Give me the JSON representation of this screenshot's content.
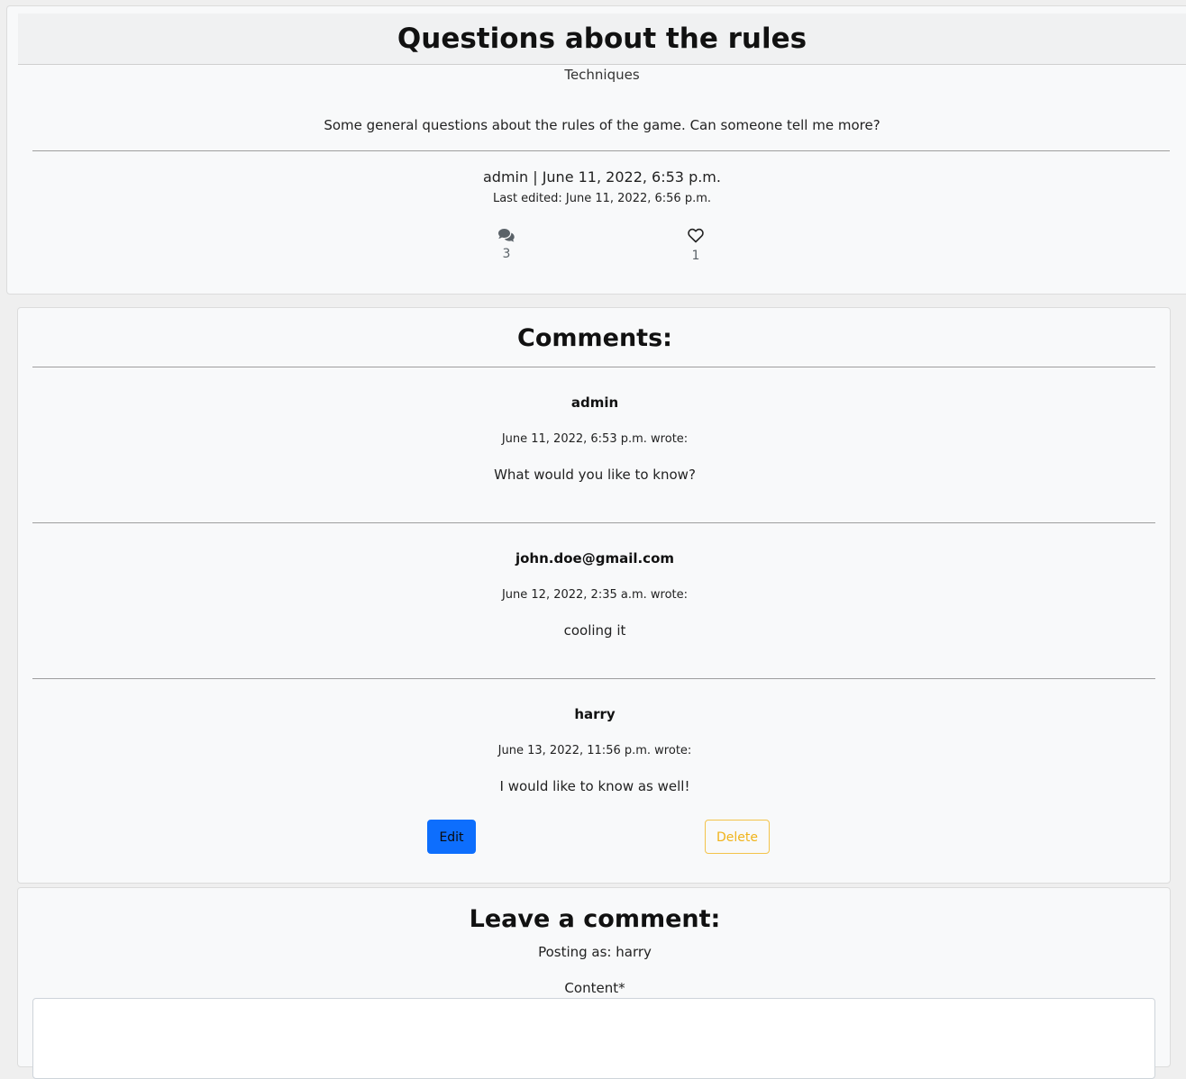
{
  "post": {
    "title": "Questions about the rules",
    "category": "Techniques",
    "body": "Some general questions about the rules of the game. Can someone tell me more?",
    "meta": "admin | June 11, 2022, 6:53 p.m.",
    "last_edited": "Last edited: June 11, 2022, 6:56 p.m.",
    "comment_count": "3",
    "like_count": "1",
    "icons": {
      "comments": "comments-icon",
      "likes": "heart-outline-icon"
    }
  },
  "comments": {
    "title": "Comments:",
    "items": [
      {
        "author": "admin",
        "date": "June 11, 2022, 6:53 p.m. wrote:",
        "text": "What would you like to know?"
      },
      {
        "author": "john.doe@gmail.com",
        "date": "June 12, 2022, 2:35 a.m. wrote:",
        "text": "cooling it"
      },
      {
        "author": "harry",
        "date": "June 13, 2022, 11:56 p.m. wrote:",
        "text": "I would like to know as well!"
      }
    ],
    "edit_label": "Edit",
    "delete_label": "Delete"
  },
  "leave_comment": {
    "title": "Leave a comment:",
    "posting_as": "Posting as: harry",
    "content_label": "Content*",
    "content_value": ""
  },
  "colors": {
    "primary": "#0d6efd",
    "warning": "#ffc107",
    "card_bg": "#f8f9fa",
    "page_bg": "#efefef"
  }
}
